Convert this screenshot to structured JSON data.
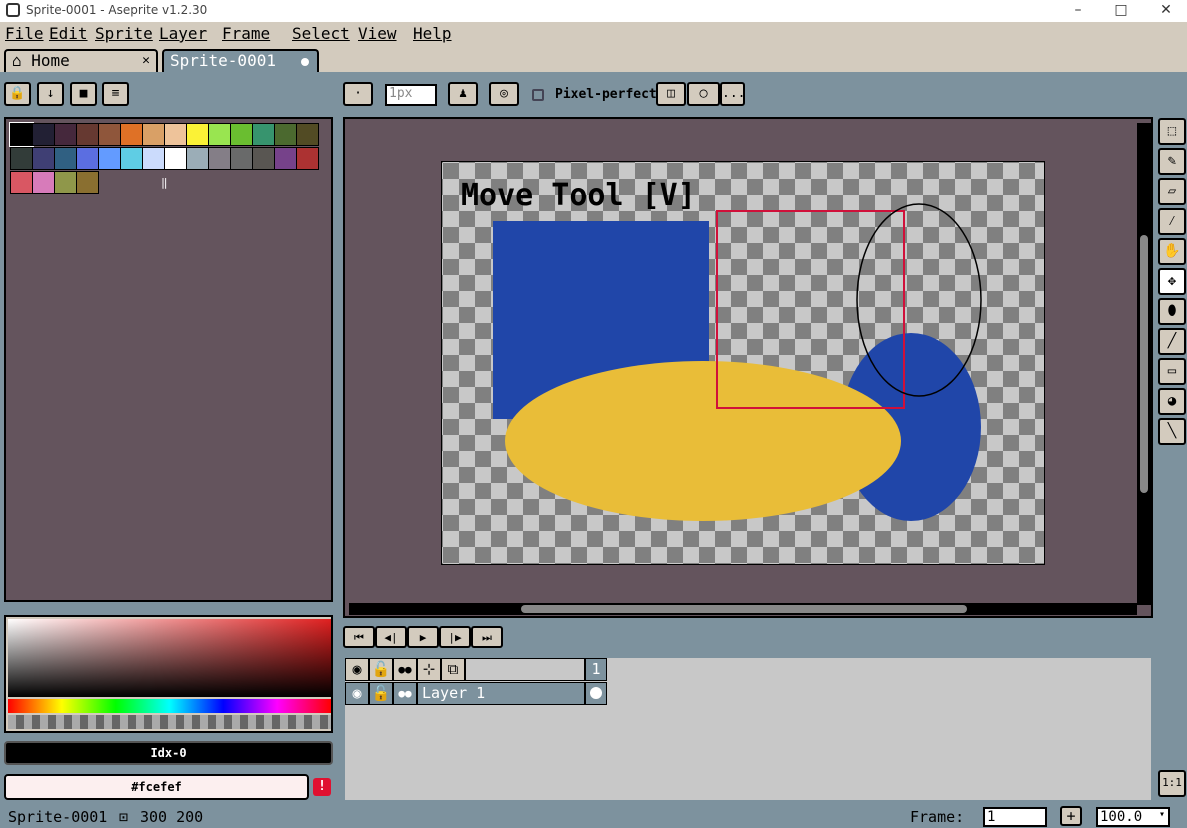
{
  "window": {
    "title": "Sprite-0001 - Aseprite v1.2.30",
    "minimize": "–",
    "maximize": "□",
    "close": "✕"
  },
  "menu": [
    "File",
    "Edit",
    "Sprite",
    "Layer",
    "Frame",
    "Select",
    "View",
    "Help"
  ],
  "tabs": [
    {
      "label": "Home",
      "close": "✕"
    },
    {
      "label": "Sprite-0001"
    }
  ],
  "context_bar": {
    "brush_size": "1px",
    "pixel_perfect": "Pixel-perfect",
    "more": "..."
  },
  "palette_colors": [
    "#000000",
    "#222034",
    "#45283c",
    "#663931",
    "#8f563b",
    "#df7126",
    "#d9a066",
    "#eec39a",
    "#fbf236",
    "#99e550",
    "#6abe30",
    "#37946e",
    "#4b692f",
    "#524b24",
    "#323c39",
    "#3f3f74",
    "#306082",
    "#5b6ee1",
    "#639bff",
    "#5fcde4",
    "#cbdbfc",
    "#ffffff",
    "#9badb7",
    "#847e87",
    "#696a6a",
    "#595652",
    "#76428a",
    "#ac3232",
    "#d95763",
    "#d77bba",
    "#8f974a",
    "#8a6f30"
  ],
  "color_index": "Idx-0",
  "hex_value": "#fcefef",
  "canvas": {
    "overlay_text": "Move Tool [V]",
    "shapes": {
      "blue": "#2046a9",
      "yellow": "#e9bd38"
    }
  },
  "animation_controls": [
    "⏮",
    "◀|",
    "▶",
    "|▶",
    "⏭"
  ],
  "timeline": {
    "frame_number": "1",
    "layer_name": "Layer 1"
  },
  "status": {
    "sprite_name": "Sprite-0001",
    "size": "300 200",
    "frame_label": "Frame:",
    "frame_value": "1",
    "zoom": "100.0",
    "plus": "+",
    "ratio": "1:1"
  }
}
